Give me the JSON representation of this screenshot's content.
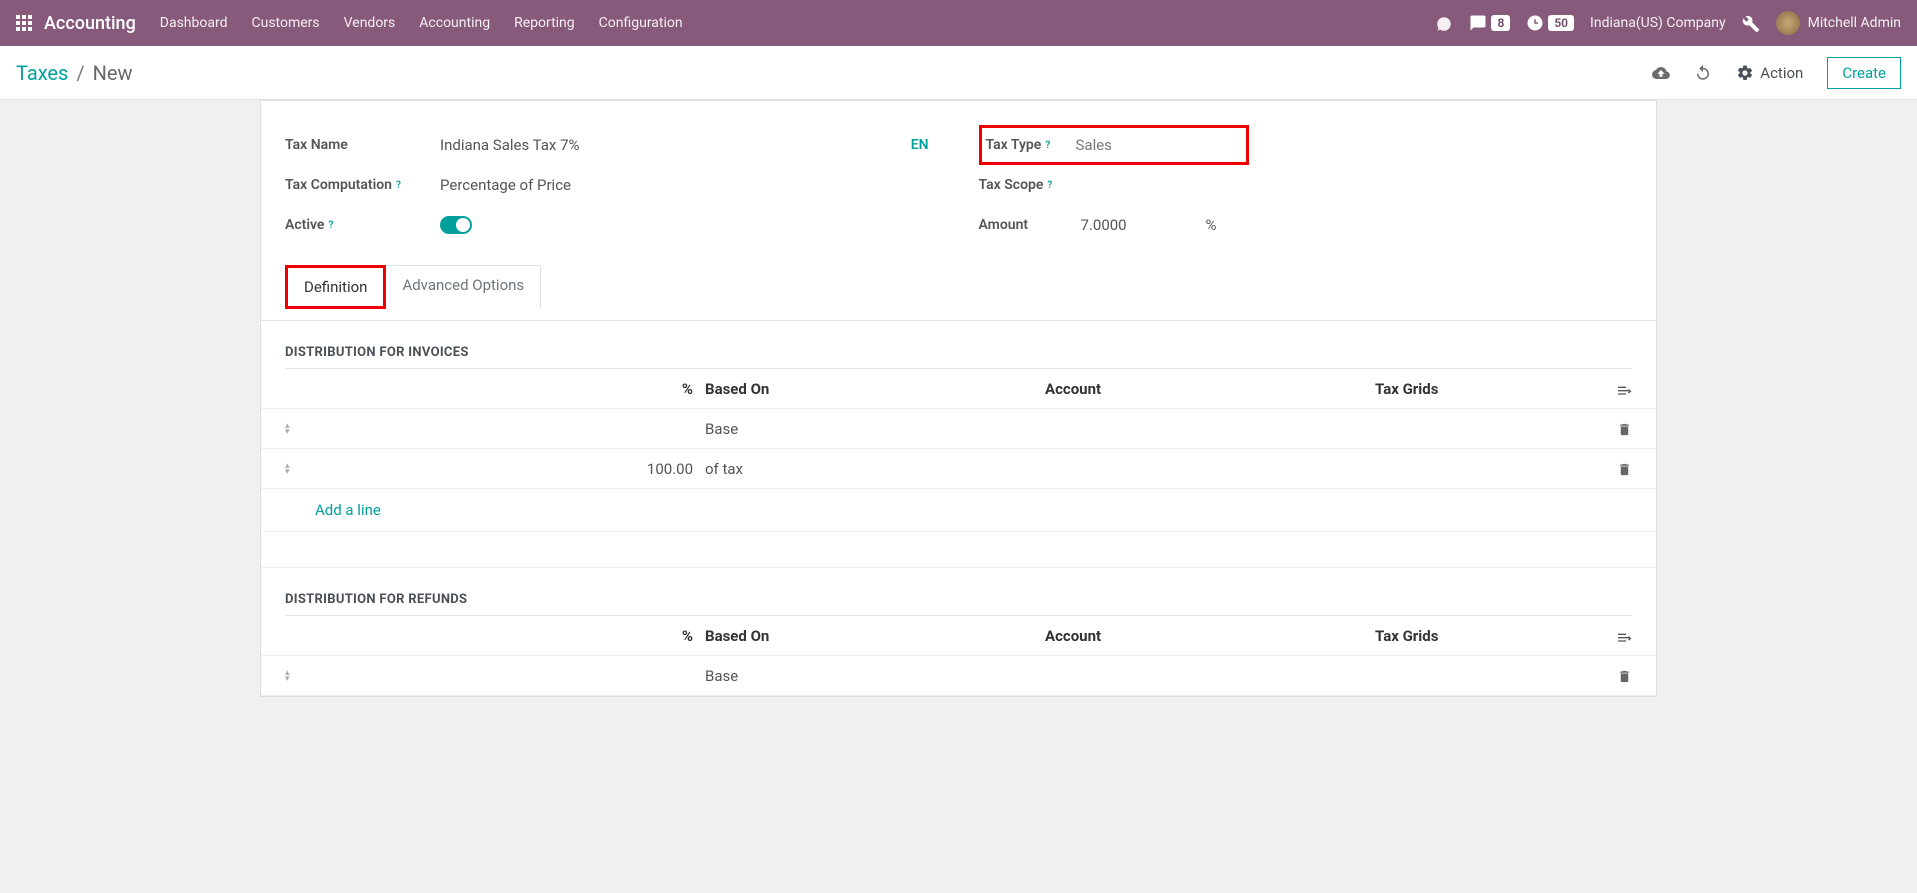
{
  "nav": {
    "brand": "Accounting",
    "items": [
      "Dashboard",
      "Customers",
      "Vendors",
      "Accounting",
      "Reporting",
      "Configuration"
    ],
    "message_count": "8",
    "activity_count": "50",
    "company": "Indiana(US) Company",
    "user": "Mitchell Admin"
  },
  "breadcrumb": {
    "parent": "Taxes",
    "current": "New"
  },
  "actions": {
    "action_label": "Action",
    "create_label": "Create"
  },
  "form": {
    "tax_name_label": "Tax Name",
    "tax_name_value": "Indiana Sales Tax 7%",
    "tax_computation_label": "Tax Computation",
    "tax_computation_value": "Percentage of Price",
    "active_label": "Active",
    "lang": "EN",
    "tax_type_label": "Tax Type",
    "tax_type_value": "Sales",
    "tax_scope_label": "Tax Scope",
    "amount_label": "Amount",
    "amount_value": "7.0000",
    "amount_unit": "%"
  },
  "tabs": {
    "definition": "Definition",
    "advanced": "Advanced Options"
  },
  "sections": {
    "invoices_title": "DISTRIBUTION FOR INVOICES",
    "refunds_title": "DISTRIBUTION FOR REFUNDS"
  },
  "table": {
    "headers": {
      "pct": "%",
      "based_on": "Based On",
      "account": "Account",
      "tax_grids": "Tax Grids"
    },
    "invoices_rows": [
      {
        "pct": "",
        "based": "Base"
      },
      {
        "pct": "100.00",
        "based": "of tax"
      }
    ],
    "refunds_rows": [
      {
        "pct": "",
        "based": "Base"
      }
    ],
    "add_line": "Add a line"
  }
}
